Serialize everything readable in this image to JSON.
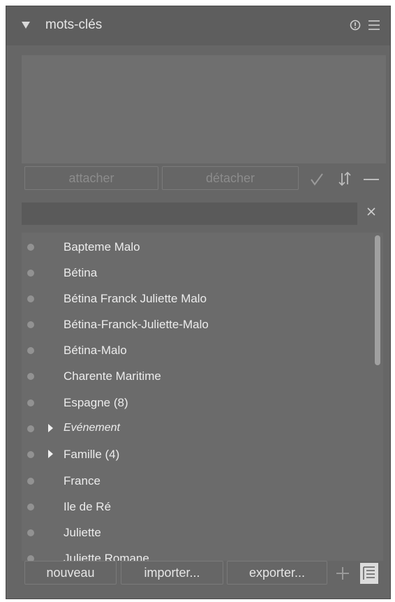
{
  "header": {
    "title": "mots-clés",
    "icons": {
      "collapse": "triangle-down-icon",
      "reset": "reset-icon",
      "menu": "hamburger-menu-icon"
    }
  },
  "actions": {
    "attach_label": "attacher",
    "detach_label": "détacher",
    "icons": [
      "check-icon",
      "sort-icon",
      "minus-icon"
    ]
  },
  "search": {
    "value": "",
    "placeholder": "",
    "clear_icon": "close-icon"
  },
  "keywords": [
    {
      "label": "Bapteme Malo",
      "expandable": false,
      "italic": false
    },
    {
      "label": "Bétina",
      "expandable": false,
      "italic": false
    },
    {
      "label": "Bétina Franck Juliette Malo",
      "expandable": false,
      "italic": false
    },
    {
      "label": "Bétina-Franck-Juliette-Malo",
      "expandable": false,
      "italic": false
    },
    {
      "label": "Bétina-Malo",
      "expandable": false,
      "italic": false
    },
    {
      "label": "Charente Maritime",
      "expandable": false,
      "italic": false
    },
    {
      "label": "Espagne (8)",
      "expandable": false,
      "italic": false
    },
    {
      "label": "Evénement",
      "expandable": true,
      "italic": true
    },
    {
      "label": "Famille (4)",
      "expandable": true,
      "italic": false
    },
    {
      "label": "France",
      "expandable": false,
      "italic": false
    },
    {
      "label": "Ile de Ré",
      "expandable": false,
      "italic": false
    },
    {
      "label": "Juliette",
      "expandable": false,
      "italic": false
    },
    {
      "label": "Juliette Romane",
      "expandable": false,
      "italic": false
    }
  ],
  "footer": {
    "new_label": "nouveau",
    "import_label": "importer...",
    "export_label": "exporter...",
    "icons": [
      "plus-icon",
      "tree-view-icon"
    ]
  },
  "colors": {
    "panel": "#666666",
    "header": "#5e5e5e",
    "text": "#ececec",
    "muted": "#8c8c8c"
  }
}
